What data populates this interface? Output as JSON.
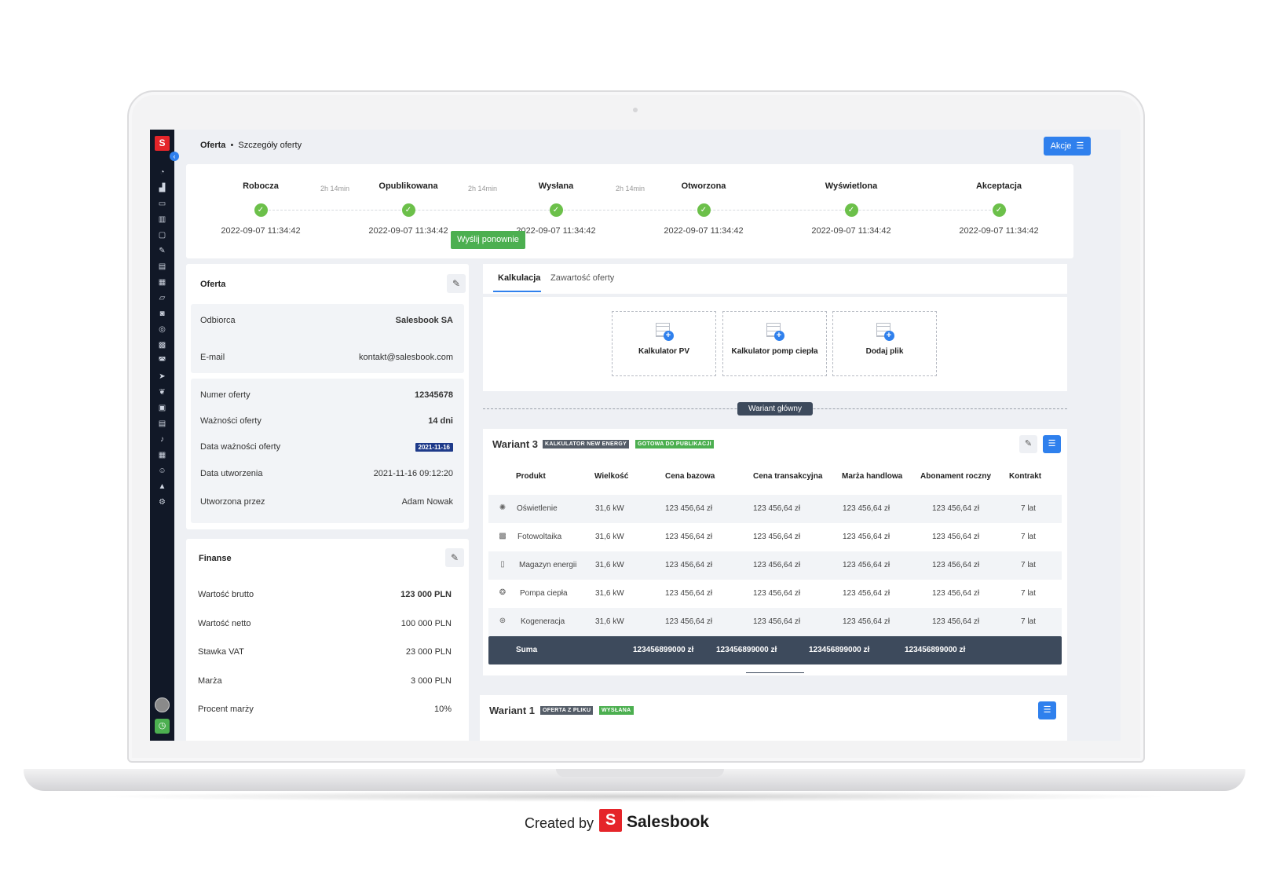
{
  "header": {
    "breadcrumb_root": "Oferta",
    "breadcrumb_sep": "•",
    "breadcrumb_page": "Szczegóły oferty",
    "actions_label": "Akcje"
  },
  "timeline": {
    "stages": [
      {
        "name": "Robocza",
        "date": "2022-09-07 11:34:42"
      },
      {
        "name": "Opublikowana",
        "date": "2022-09-07 11:34:42"
      },
      {
        "name": "Wysłana",
        "date": "2022-09-07 11:34:42"
      },
      {
        "name": "Otworzona",
        "date": "2022-09-07 11:34:42"
      },
      {
        "name": "Wyświetlona",
        "date": "2022-09-07 11:34:42"
      },
      {
        "name": "Akceptacja",
        "date": "2022-09-07 11:34:42"
      }
    ],
    "durations": [
      "2h 14min",
      "2h 14min",
      "2h 14min"
    ],
    "resend_label": "Wyślij ponownie"
  },
  "offer": {
    "title": "Oferta",
    "recipient_label": "Odbiorca",
    "recipient_value": "Salesbook SA",
    "email_label": "E-mail",
    "email_value": "kontakt@salesbook.com",
    "number_label": "Numer oferty",
    "number_value": "12345678",
    "validity_label": "Ważności oferty",
    "validity_value": "14 dni",
    "validity_date_label": "Data ważności oferty",
    "validity_date_value": "2021-11-16",
    "created_label": "Data utworzenia",
    "created_value": "2021-11-16 09:12:20",
    "created_by_label": "Utworzona przez",
    "created_by_value": "Adam Nowak"
  },
  "finance": {
    "title": "Finanse",
    "gross_label": "Wartość brutto",
    "gross_value": "123 000 PLN",
    "net_label": "Wartość netto",
    "net_value": "100 000 PLN",
    "vat_label": "Stawka VAT",
    "vat_value": "23 000 PLN",
    "margin_label": "Marża",
    "margin_value": "3 000 PLN",
    "margin_pct_label": "Procent marży",
    "margin_pct_value": "10%"
  },
  "tabs": [
    "Kalkulacja",
    "Zawartość oferty"
  ],
  "calculators": [
    "Kalkulator PV",
    "Kalkulator pomp ciepła",
    "Dodaj plik"
  ],
  "variant_main_label": "Wariant główny",
  "variant3": {
    "title": "Wariant 3",
    "tag1": "KALKULATOR NEW ENERGY",
    "tag2": "GOTOWA DO PUBLIKACJI",
    "headers": [
      "Produkt",
      "Wielkość",
      "Cena bazowa",
      "Cena transakcyjna",
      "Marża handlowa",
      "Abonament roczny",
      "Kontrakt"
    ],
    "rows": [
      {
        "product": "Oświetlenie",
        "size": "31,6 kW",
        "base": "123 456,64 zł",
        "trans": "123 456,64 zł",
        "margin": "123 456,64 zł",
        "sub": "123 456,64 zł",
        "contract": "7 lat"
      },
      {
        "product": "Fotowoltaika",
        "size": "31,6 kW",
        "base": "123 456,64 zł",
        "trans": "123 456,64 zł",
        "margin": "123 456,64 zł",
        "sub": "123 456,64 zł",
        "contract": "7 lat"
      },
      {
        "product": "Magazyn energii",
        "size": "31,6 kW",
        "base": "123 456,64 zł",
        "trans": "123 456,64 zł",
        "margin": "123 456,64 zł",
        "sub": "123 456,64 zł",
        "contract": "7 lat"
      },
      {
        "product": "Pompa ciepła",
        "size": "31,6 kW",
        "base": "123 456,64 zł",
        "trans": "123 456,64 zł",
        "margin": "123 456,64 zł",
        "sub": "123 456,64 zł",
        "contract": "7 lat"
      },
      {
        "product": "Kogeneracja",
        "size": "31,6 kW",
        "base": "123 456,64 zł",
        "trans": "123 456,64 zł",
        "margin": "123 456,64 zł",
        "sub": "123 456,64 zł",
        "contract": "7 lat"
      }
    ],
    "sum_label": "Suma",
    "sum_values": [
      "123456899000 zł",
      "123456899000 zł",
      "123456899000 zł",
      "123456899000 zł"
    ]
  },
  "variant1": {
    "title": "Wariant 1",
    "tag1": "OFERTA Z PLIKU",
    "tag2": "WYSŁANA"
  },
  "footer": {
    "created_by": "Created by",
    "brand": "Salesbook",
    "logo_letter": "S"
  },
  "colors": {
    "accent": "#2f80ed",
    "success": "#4caf50",
    "sidebar": "#111827",
    "sum_bar": "#3d4a5c",
    "brand_red": "#e5252a"
  }
}
